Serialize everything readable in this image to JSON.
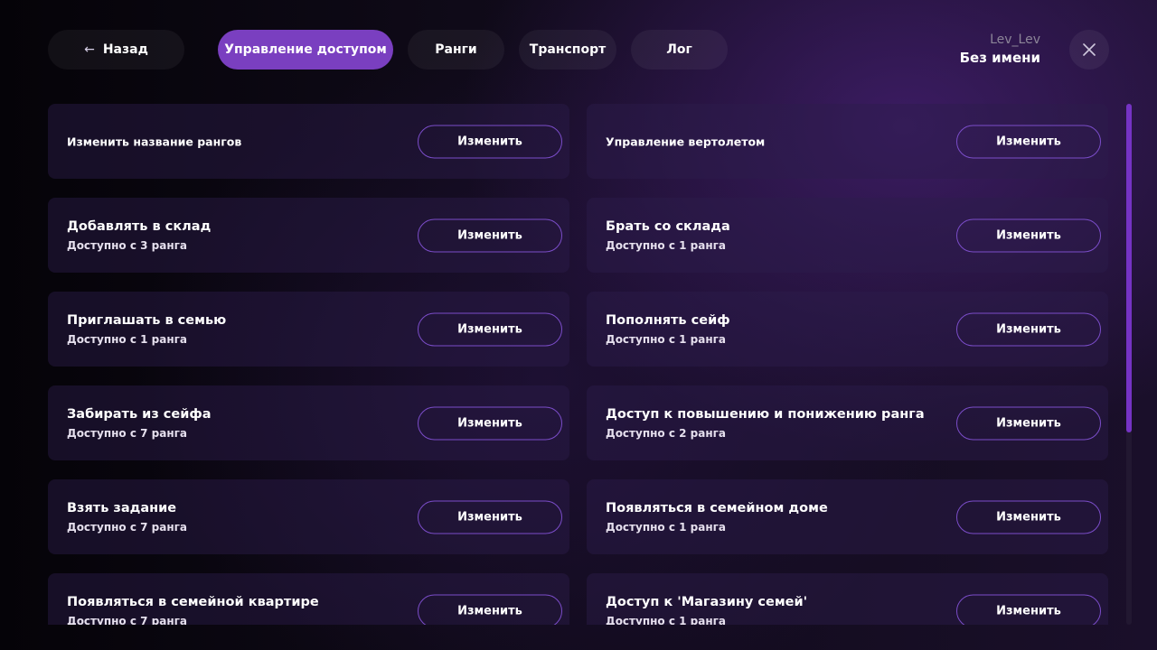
{
  "header": {
    "back_label": "Назад",
    "tabs": [
      {
        "label": "Управление доступом",
        "active": true
      },
      {
        "label": "Ранги",
        "active": false
      },
      {
        "label": "Транспорт",
        "active": false
      },
      {
        "label": "Лог",
        "active": false
      }
    ],
    "user": {
      "nickname": "Lev_Lev",
      "name": "Без имени"
    }
  },
  "permissions": [
    {
      "title": "Изменить название рангов",
      "subtitle": "",
      "button": "Изменить"
    },
    {
      "title": "Управление вертолетом",
      "subtitle": "",
      "button": "Изменить"
    },
    {
      "title": "Добавлять в склад",
      "subtitle": "Доступно с 3 ранга",
      "button": "Изменить"
    },
    {
      "title": "Брать со склада",
      "subtitle": "Доступно с 1 ранга",
      "button": "Изменить"
    },
    {
      "title": "Приглашать в семью",
      "subtitle": "Доступно с 1 ранга",
      "button": "Изменить"
    },
    {
      "title": "Пополнять сейф",
      "subtitle": "Доступно с 1 ранга",
      "button": "Изменить"
    },
    {
      "title": "Забирать из сейфа",
      "subtitle": "Доступно с 7 ранга",
      "button": "Изменить"
    },
    {
      "title": "Доступ к повышению и понижению ранга",
      "subtitle": "Доступно с 2 ранга",
      "button": "Изменить"
    },
    {
      "title": "Взять задание",
      "subtitle": "Доступно с 7 ранга",
      "button": "Изменить"
    },
    {
      "title": "Появляться в семейном доме",
      "subtitle": "Доступно с 1 ранга",
      "button": "Изменить"
    },
    {
      "title": "Появляться в семейной квартире",
      "subtitle": "Доступно с 7 ранга",
      "button": "Изменить"
    },
    {
      "title": "Доступ к 'Магазину семей'",
      "subtitle": "Доступно с 1 ранга",
      "button": "Изменить"
    }
  ],
  "icons": {
    "back": "arrow-left-icon",
    "close": "close-icon"
  },
  "colors": {
    "accent": "#7a3fc0",
    "button_border": "#7b4dc9",
    "scrollbar": "#7533c4"
  },
  "scroll": {
    "position_fraction": 0.0,
    "visible_fraction": 0.63
  }
}
